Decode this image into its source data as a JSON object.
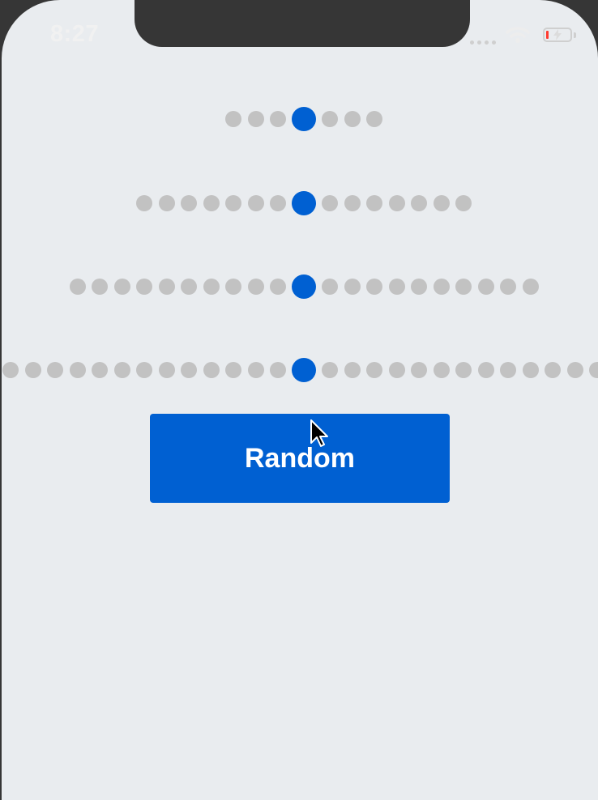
{
  "status_bar": {
    "time": "8:27",
    "icons": [
      "signal-dots-icon",
      "wifi-icon",
      "battery-low-charging-icon"
    ],
    "battery_color": "#ff3b30"
  },
  "colors": {
    "background": "#e9ecef",
    "dot_inactive": "#c2c2c2",
    "dot_active": "#0060d2",
    "button": "#0060d2",
    "button_text": "#ffffff"
  },
  "dot_rows": [
    {
      "name": "indicator-row-1",
      "left_count": 3,
      "right_count": 3
    },
    {
      "name": "indicator-row-2",
      "left_count": 7,
      "right_count": 7
    },
    {
      "name": "indicator-row-3",
      "left_count": 10,
      "right_count": 10
    },
    {
      "name": "indicator-row-4",
      "left_count": 13,
      "right_count": 13
    }
  ],
  "actions": {
    "random_label": "Random"
  }
}
